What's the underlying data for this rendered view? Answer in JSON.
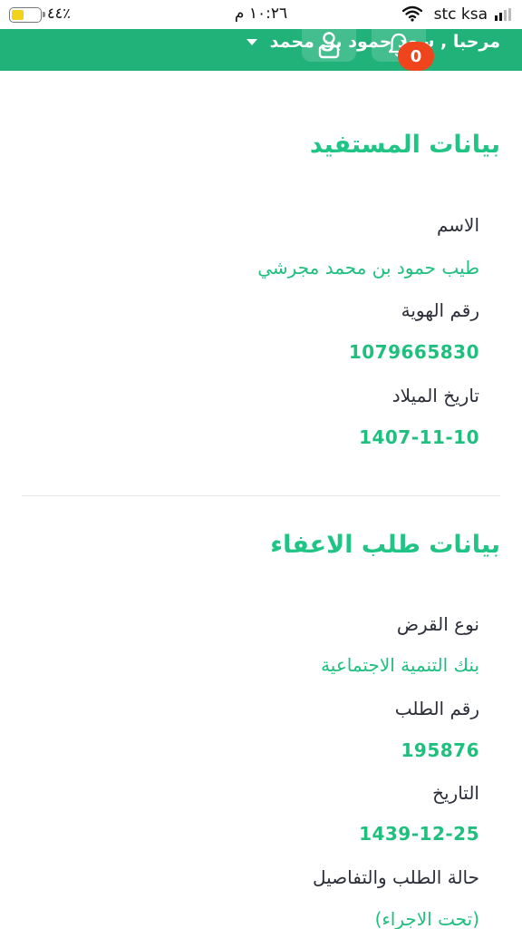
{
  "status_bar": {
    "carrier": "stc ksa",
    "time": "١٠:٢٦ م",
    "battery_percent": "٤٤٪",
    "battery_level": 0.44
  },
  "header": {
    "greeting": "مرحبا , سعد حمود بن محمد",
    "notification_count": "0",
    "color": "#21b27a"
  },
  "beneficiary": {
    "title": "بيانات المستفيد",
    "name_label": "الاسم",
    "name_value": "طيب حمود بن محمد مجرشي",
    "id_label": "رقم الهوية",
    "id_value": "1079665830",
    "dob_label": "تاريخ الميلاد",
    "dob_value": "1407-11-10"
  },
  "exemption_request": {
    "title": "بيانات طلب الاعفاء",
    "loan_type_label": "نوع القرض",
    "loan_type_value": "بنك التنمية الاجتماعية",
    "request_no_label": "رقم الطلب",
    "request_no_value": "195876",
    "date_label": "التاريخ",
    "date_value": "1439-12-25",
    "status_label": "حالة الطلب والتفاصيل",
    "status_value": "(تحت الاجراء)"
  },
  "icons": {
    "notifications": "bell-icon",
    "profile": "person-icon",
    "menu": "caret-down-icon",
    "wifi": "wifi-icon",
    "signal": "signal-icon",
    "battery": "battery-icon"
  },
  "colors": {
    "accent": "#20c586",
    "badge": "#f0441c",
    "text": "#2b2e38"
  }
}
